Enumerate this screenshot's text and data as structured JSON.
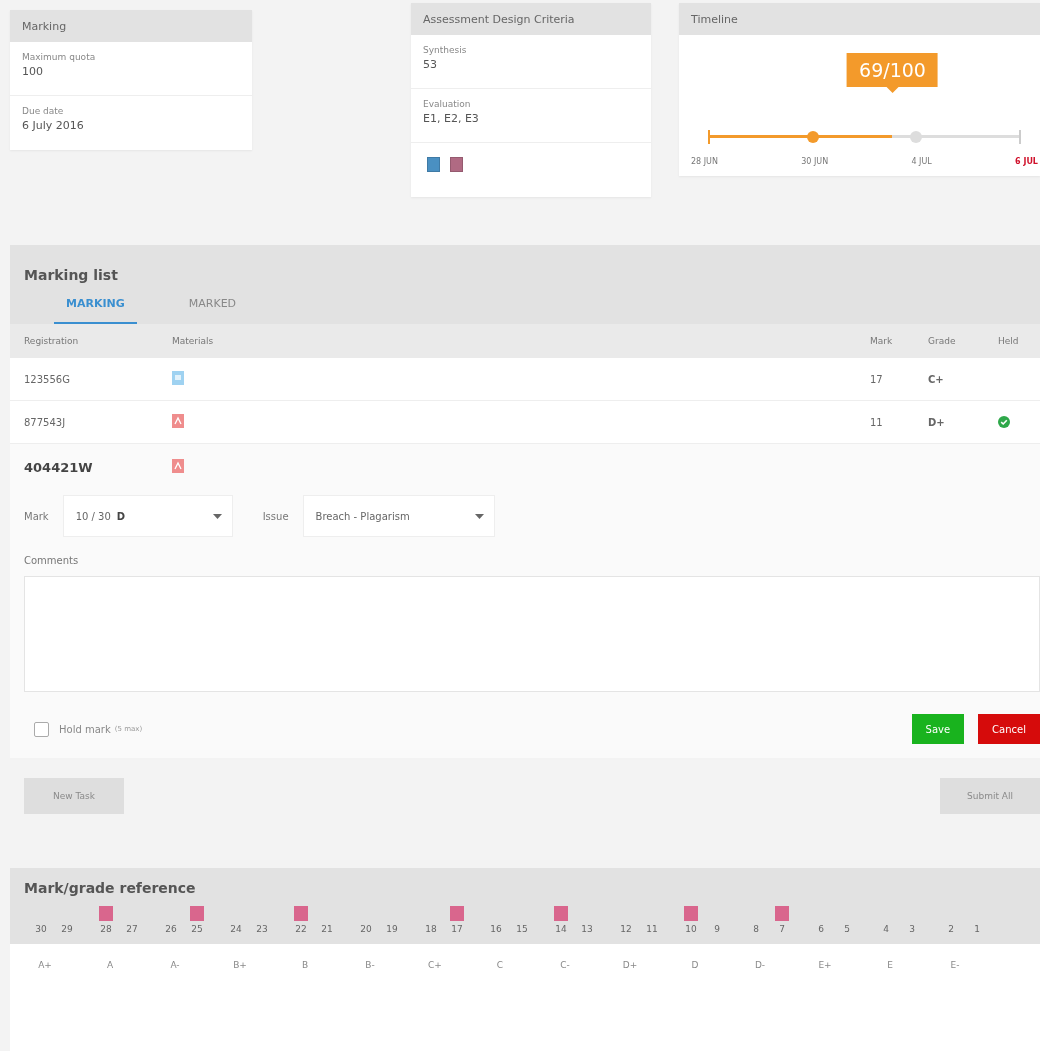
{
  "marking_card": {
    "title": "Marking",
    "fields": [
      {
        "label": "Maximum quota",
        "value": "100"
      },
      {
        "label": "Due date",
        "value": "6 July 2016"
      }
    ]
  },
  "criteria_card": {
    "title": "Assessment Design Criteria",
    "fields": [
      {
        "label": "Synthesis",
        "value": "53"
      },
      {
        "label": "Evaluation",
        "value": "E1, E2, E3"
      }
    ],
    "badges": [
      {
        "kind": "blue"
      },
      {
        "kind": "pink"
      }
    ]
  },
  "timeline": {
    "title": "Timeline",
    "progress": "69/100",
    "level": 0.59,
    "dates": [
      {
        "label": "28 JUN",
        "kind": "start"
      },
      {
        "label": "30 JUN",
        "kind": "reached"
      },
      {
        "label": "4 JUL",
        "kind": "pending"
      },
      {
        "label": "6 JUL",
        "kind": "due"
      }
    ]
  },
  "marking_list": {
    "title": "Marking list",
    "tabs": [
      {
        "label": "MARKING",
        "selected": true
      },
      {
        "label": "MARKED",
        "selected": false
      }
    ],
    "columns": [
      "Registration",
      "Materials",
      "Mark",
      "Grade",
      "Held"
    ],
    "rows": [
      {
        "registration": "123556G",
        "material": {
          "kind": "doc"
        },
        "mark": "17",
        "grade": "C+",
        "held": false
      },
      {
        "registration": "877543J",
        "material": {
          "kind": "pdf"
        },
        "mark": "11",
        "grade": "D+",
        "held": true
      }
    ],
    "editor": {
      "registration": "404421W",
      "material": {
        "kind": "pdf"
      },
      "mark_label": "Mark",
      "mark_value": "10 / 30",
      "mark_grade": "D",
      "issue_label": "Issue",
      "issue_value": "Breach - Plagarism",
      "comments_label": "Comments",
      "hold_label": "Hold mark",
      "hold_note": "(5 max)",
      "hold_checked": false,
      "save": "Save",
      "cancel": "Cancel"
    }
  },
  "actions": [
    {
      "label": "New Task",
      "disabled": true
    },
    {
      "label": "Submit All",
      "disabled": true
    }
  ],
  "reference": {
    "title": "Mark/grade reference",
    "grades": [
      {
        "grade": "A+",
        "marks": [
          {
            "value": "30",
            "flagged": false
          },
          {
            "value": "29",
            "flagged": false
          }
        ]
      },
      {
        "grade": "A",
        "marks": [
          {
            "value": "28",
            "flagged": true
          },
          {
            "value": "27",
            "flagged": false
          }
        ]
      },
      {
        "grade": "A-",
        "marks": [
          {
            "value": "26",
            "flagged": false
          },
          {
            "value": "25",
            "flagged": true
          }
        ]
      },
      {
        "grade": "B+",
        "marks": [
          {
            "value": "24",
            "flagged": false
          },
          {
            "value": "23",
            "flagged": false
          }
        ]
      },
      {
        "grade": "B",
        "marks": [
          {
            "value": "22",
            "flagged": true
          },
          {
            "value": "21",
            "flagged": false
          }
        ]
      },
      {
        "grade": "B-",
        "marks": [
          {
            "value": "20",
            "flagged": false
          },
          {
            "value": "19",
            "flagged": false
          }
        ]
      },
      {
        "grade": "C+",
        "marks": [
          {
            "value": "18",
            "flagged": false
          },
          {
            "value": "17",
            "flagged": true
          }
        ]
      },
      {
        "grade": "C",
        "marks": [
          {
            "value": "16",
            "flagged": false
          },
          {
            "value": "15",
            "flagged": false
          }
        ]
      },
      {
        "grade": "C-",
        "marks": [
          {
            "value": "14",
            "flagged": true
          },
          {
            "value": "13",
            "flagged": false
          }
        ]
      },
      {
        "grade": "D+",
        "marks": [
          {
            "value": "12",
            "flagged": false
          },
          {
            "value": "11",
            "flagged": false
          }
        ]
      },
      {
        "grade": "D",
        "marks": [
          {
            "value": "10",
            "flagged": true
          },
          {
            "value": "9",
            "flagged": false
          }
        ]
      },
      {
        "grade": "D-",
        "marks": [
          {
            "value": "8",
            "flagged": false
          },
          {
            "value": "7",
            "flagged": true
          }
        ]
      },
      {
        "grade": "E+",
        "marks": [
          {
            "value": "6",
            "flagged": false
          },
          {
            "value": "5",
            "flagged": false
          }
        ]
      },
      {
        "grade": "E",
        "marks": [
          {
            "value": "4",
            "flagged": false
          },
          {
            "value": "3",
            "flagged": false
          }
        ]
      },
      {
        "grade": "E-",
        "marks": [
          {
            "value": "2",
            "flagged": false
          },
          {
            "value": "1",
            "flagged": false
          }
        ]
      }
    ]
  }
}
